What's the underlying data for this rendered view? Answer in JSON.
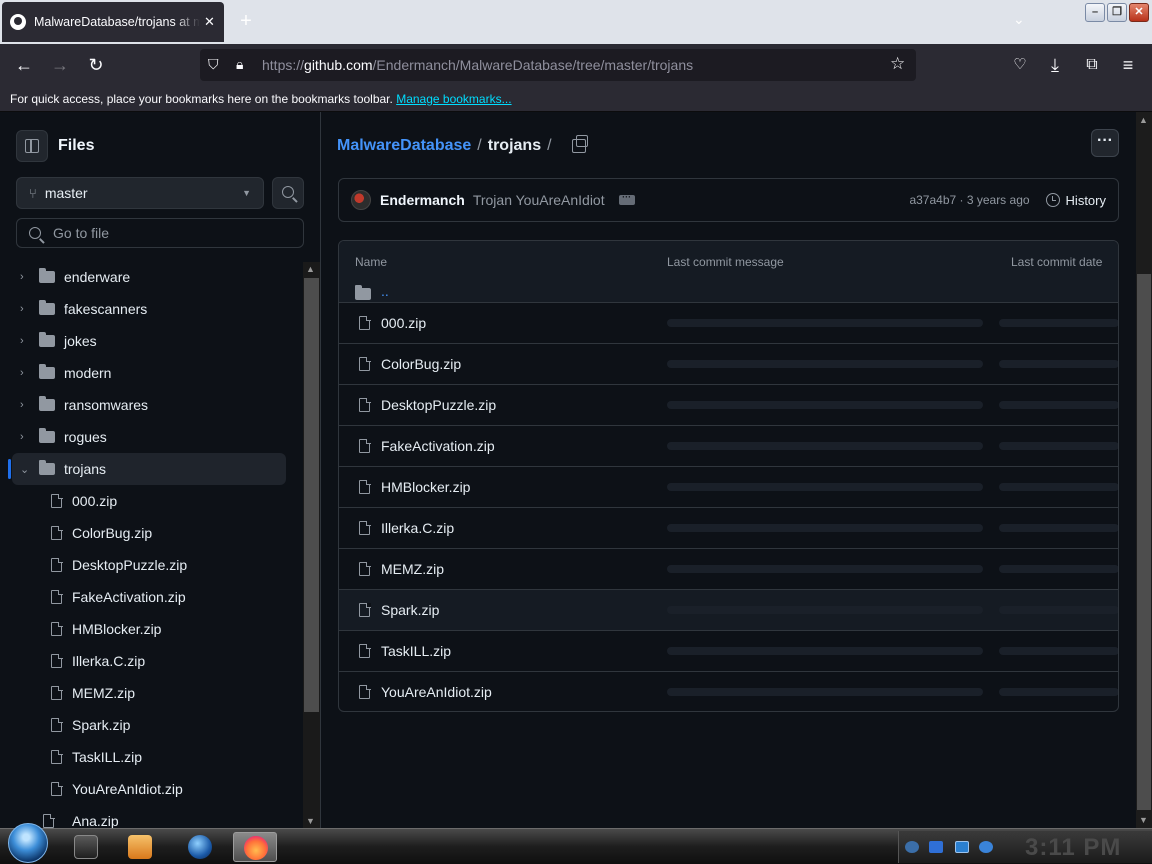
{
  "browser": {
    "tab_title": "MalwareDatabase/trojans at master",
    "tab_close": "✕",
    "new_tab": "+",
    "url_prefix": "https://",
    "url_host": "github.com",
    "url_path": "/Endermanch/MalwareDatabase/tree/master/trojans",
    "bookmarks_text": "For quick access, place your bookmarks here on the bookmarks toolbar.",
    "bookmarks_link": "Manage bookmarks..."
  },
  "sidebar": {
    "title": "Files",
    "branch": "master",
    "goto_placeholder": "Go to file",
    "folders": [
      {
        "label": "enderware"
      },
      {
        "label": "fakescanners"
      },
      {
        "label": "jokes"
      },
      {
        "label": "modern"
      },
      {
        "label": "ransomwares"
      },
      {
        "label": "rogues"
      },
      {
        "label": "trojans"
      }
    ],
    "trojan_files": [
      "000.zip",
      "ColorBug.zip",
      "DesktopPuzzle.zip",
      "FakeActivation.zip",
      "HMBlocker.zip",
      "Illerka.C.zip",
      "MEMZ.zip",
      "Spark.zip",
      "TaskILL.zip",
      "YouAreAnIdiot.zip"
    ],
    "root_files": [
      "Ana.zip"
    ]
  },
  "main": {
    "breadcrumb_repo": "MalwareDatabase",
    "breadcrumb_sep": "/",
    "breadcrumb_folder": "trojans",
    "more": "···",
    "commit": {
      "author": "Endermanch",
      "message": "Trojan YouAreAnIdiot",
      "dots": "···",
      "hash_age": "a37a4b7 · 3 years ago",
      "history": "History"
    },
    "table": {
      "col_name": "Name",
      "col_message": "Last commit message",
      "col_date": "Last commit date",
      "parent": "..",
      "files": [
        "000.zip",
        "ColorBug.zip",
        "DesktopPuzzle.zip",
        "FakeActivation.zip",
        "HMBlocker.zip",
        "Illerka.C.zip",
        "MEMZ.zip",
        "Spark.zip",
        "TaskILL.zip",
        "YouAreAnIdiot.zip"
      ]
    }
  },
  "taskbar": {
    "clock": "3:11 PM"
  }
}
